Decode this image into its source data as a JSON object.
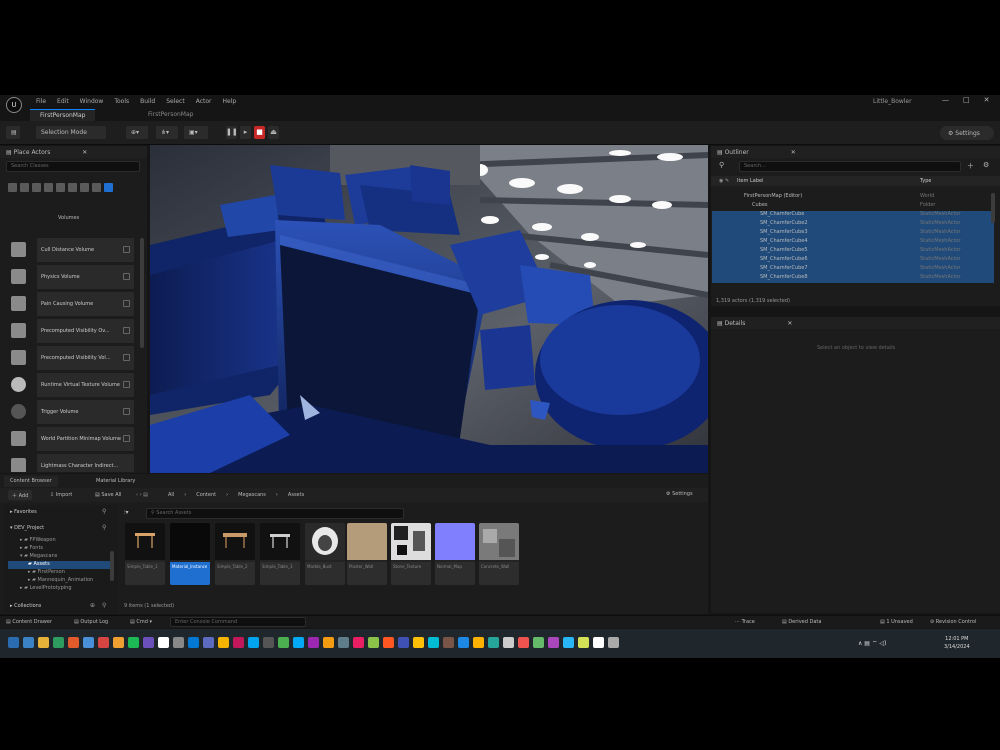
{
  "menu": {
    "items": [
      "File",
      "Edit",
      "Window",
      "Tools",
      "Build",
      "Select",
      "Actor",
      "Help"
    ],
    "project": "Little_Bowler"
  },
  "tabs": [
    "FirstPersonMap",
    "FirstPersonMap"
  ],
  "toolbar": {
    "save_label": "",
    "mode_label": "Selection Mode",
    "settings_label": "Settings"
  },
  "place_actors": {
    "title": "Place Actors",
    "search_placeholder": "Search Classes",
    "category": "Volumes",
    "items": [
      "Cull Distance Volume",
      "Physics Volume",
      "Pain Causing Volume",
      "Precomputed Visibility Ov...",
      "Precomputed Visibility Vol...",
      "Runtime Virtual Texture Volume",
      "Trigger Volume",
      "World Partition Minimap Volume",
      "Lightmass Character Indirect..."
    ]
  },
  "outliner": {
    "title": "Outliner",
    "search_placeholder": "Search...",
    "col_label": "Item Label",
    "col_type": "Type",
    "rows": [
      {
        "name": "FirstPersonMap (Editor)",
        "type": "World"
      },
      {
        "name": "Cubes",
        "type": "Folder"
      },
      {
        "name": "SM_ChamferCube",
        "type": "StaticMeshActor"
      },
      {
        "name": "SM_ChamferCube2",
        "type": "StaticMeshActor"
      },
      {
        "name": "SM_ChamferCube3",
        "type": "StaticMeshActor"
      },
      {
        "name": "SM_ChamferCube4",
        "type": "StaticMeshActor"
      },
      {
        "name": "SM_ChamferCube5",
        "type": "StaticMeshActor"
      },
      {
        "name": "SM_ChamferCube6",
        "type": "StaticMeshActor"
      },
      {
        "name": "SM_ChamferCube7",
        "type": "StaticMeshActor"
      },
      {
        "name": "SM_ChamferCube8",
        "type": "StaticMeshActor"
      }
    ],
    "count": "1,319 actors (1,319 selected)"
  },
  "details": {
    "title": "Details",
    "empty_text": "Select an object to view details"
  },
  "content": {
    "tabs": [
      "Content Browser",
      "Material Library"
    ],
    "add_label": "Add",
    "import_label": "Import",
    "save_all_label": "Save All",
    "breadcrumb": [
      "All",
      "Content",
      "Megascans",
      "Assets"
    ],
    "settings_label": "Settings",
    "favorites": "Favorites",
    "project": "DEV_Project",
    "tree": [
      "FPWeapon",
      "Fonts",
      "Megascans",
      "Assets",
      "FirstPerson",
      "Mannequin_Animation",
      "LevelPrototyping"
    ],
    "collections": "Collections",
    "search_placeholder": "Search Assets",
    "assets": [
      "Simple_Table_1",
      "Material_Instance",
      "Simple_Table_2",
      "Simple_Table_3",
      "Marble_Bust",
      "Plaster_Wall",
      "Stone_Texture",
      "Normal_Map",
      "Concrete_Wall"
    ],
    "items_text": "9 items (1 selected)"
  },
  "status": {
    "content_drawer": "Content Drawer",
    "output_log": "Output Log",
    "cmd": "Cmd",
    "cmd_placeholder": "Enter Console Command",
    "trace": "Trace",
    "derived_data": "Derived Data",
    "unsaved": "1 Unsaved",
    "revision_control": "Revision Control"
  },
  "clock": {
    "time": "12:01 PM",
    "date": "3/14/2024"
  },
  "taskbar_icons": [
    "#2b6cb0",
    "#3b82c4",
    "#e8b339",
    "#2e9c5e",
    "#e05a2b",
    "#4a90d9",
    "#d64541",
    "#f0a030",
    "#1db954",
    "#6b4fbb",
    "#ffffff",
    "#888888",
    "#0078d4",
    "#5c6bc0",
    "#f4b400",
    "#c2185b",
    "#00a4ef",
    "#555555",
    "#4caf50",
    "#03a9f4",
    "#9c27b0",
    "#f39c12",
    "#607d8b",
    "#e91e63",
    "#8bc34a",
    "#ff5722",
    "#3f51b5",
    "#ffc107",
    "#00bcd4",
    "#795548",
    "#1e88e5",
    "#ffb300",
    "#26a69a",
    "#cccccc",
    "#ef5350",
    "#66bb6a",
    "#ab47bc",
    "#29b6f6",
    "#d4e157",
    "#ffffff",
    "#aaaaaa"
  ]
}
